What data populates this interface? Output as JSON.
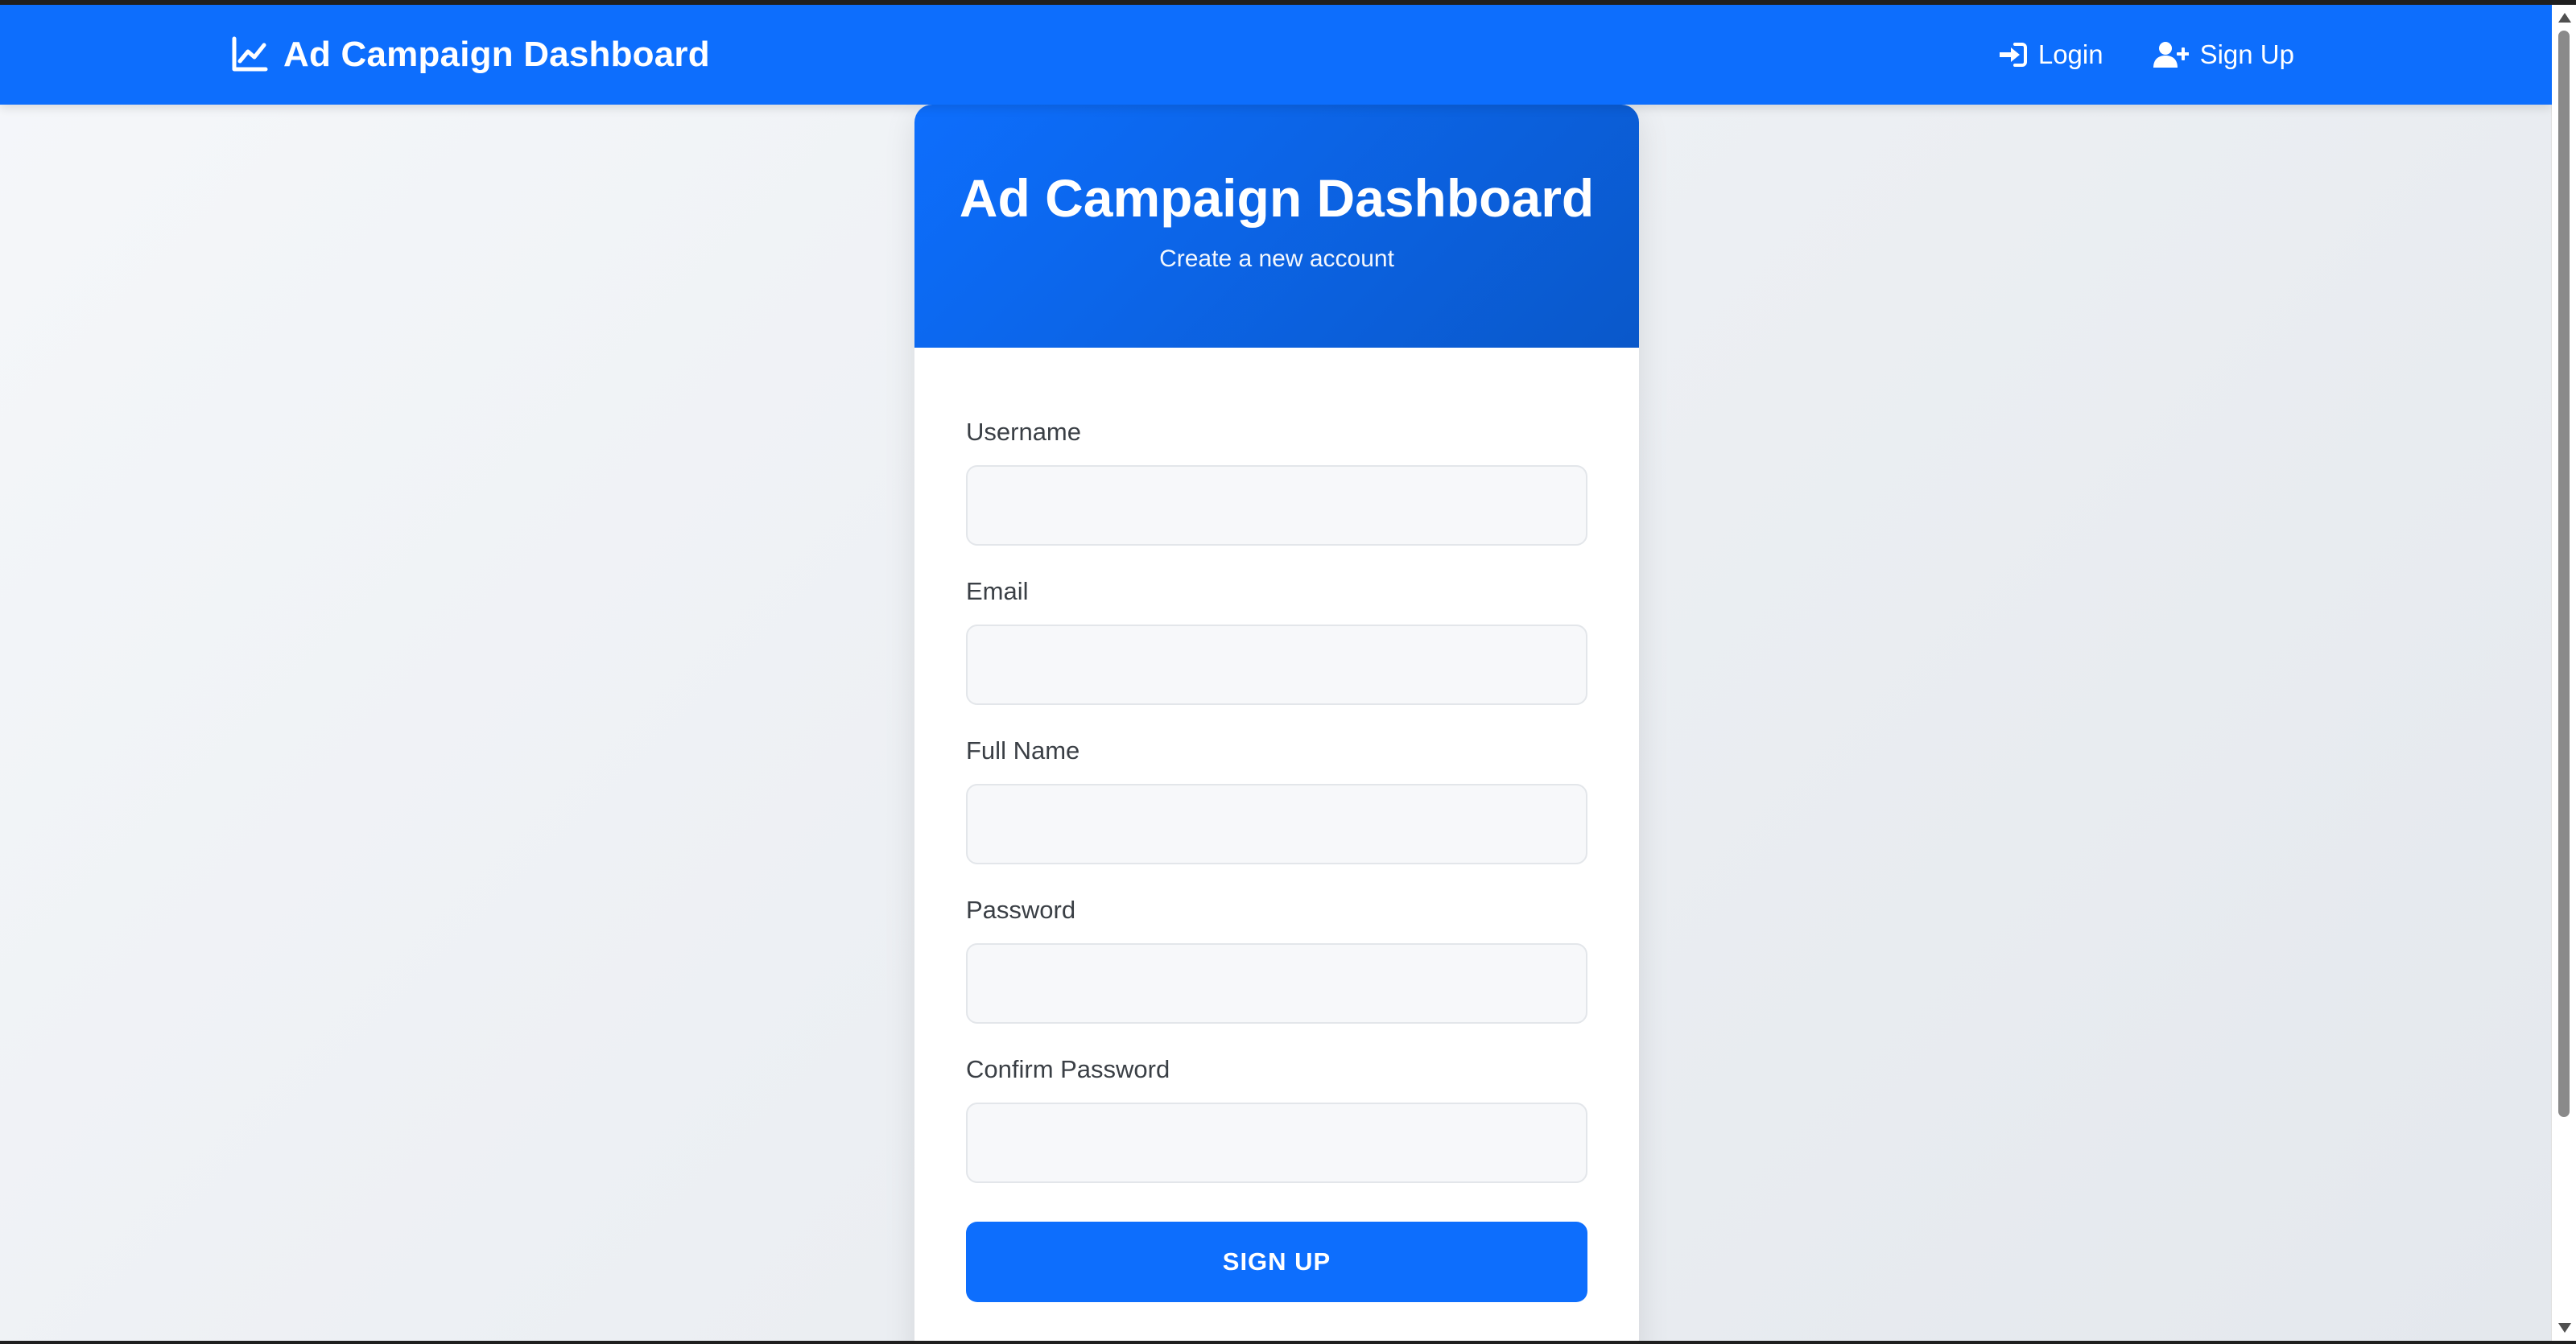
{
  "navbar": {
    "brand": "Ad Campaign Dashboard",
    "brand_icon": "chart-line-icon",
    "links": [
      {
        "label": "Login",
        "icon": "sign-in-icon"
      },
      {
        "label": "Sign Up",
        "icon": "user-plus-icon"
      }
    ],
    "color": "#0d6efd"
  },
  "card": {
    "title": "Ad Campaign Dashboard",
    "subtitle": "Create a new account",
    "fields": [
      {
        "label": "Username",
        "value": "",
        "type": "text"
      },
      {
        "label": "Email",
        "value": "",
        "type": "email"
      },
      {
        "label": "Full Name",
        "value": "",
        "type": "text"
      },
      {
        "label": "Password",
        "value": "",
        "type": "password"
      },
      {
        "label": "Confirm Password",
        "value": "",
        "type": "password"
      }
    ],
    "submit_label": "SIGN UP"
  }
}
